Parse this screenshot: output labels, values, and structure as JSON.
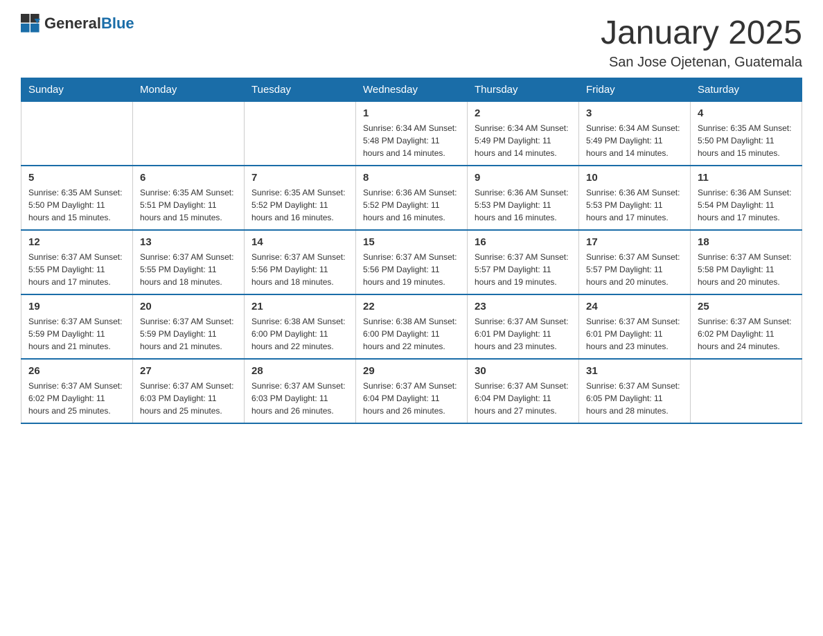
{
  "header": {
    "logo": {
      "general": "General",
      "blue": "Blue"
    },
    "title": "January 2025",
    "location": "San Jose Ojetenan, Guatemala"
  },
  "weekdays": [
    "Sunday",
    "Monday",
    "Tuesday",
    "Wednesday",
    "Thursday",
    "Friday",
    "Saturday"
  ],
  "weeks": [
    [
      {
        "day": "",
        "info": ""
      },
      {
        "day": "",
        "info": ""
      },
      {
        "day": "",
        "info": ""
      },
      {
        "day": "1",
        "info": "Sunrise: 6:34 AM\nSunset: 5:48 PM\nDaylight: 11 hours\nand 14 minutes."
      },
      {
        "day": "2",
        "info": "Sunrise: 6:34 AM\nSunset: 5:49 PM\nDaylight: 11 hours\nand 14 minutes."
      },
      {
        "day": "3",
        "info": "Sunrise: 6:34 AM\nSunset: 5:49 PM\nDaylight: 11 hours\nand 14 minutes."
      },
      {
        "day": "4",
        "info": "Sunrise: 6:35 AM\nSunset: 5:50 PM\nDaylight: 11 hours\nand 15 minutes."
      }
    ],
    [
      {
        "day": "5",
        "info": "Sunrise: 6:35 AM\nSunset: 5:50 PM\nDaylight: 11 hours\nand 15 minutes."
      },
      {
        "day": "6",
        "info": "Sunrise: 6:35 AM\nSunset: 5:51 PM\nDaylight: 11 hours\nand 15 minutes."
      },
      {
        "day": "7",
        "info": "Sunrise: 6:35 AM\nSunset: 5:52 PM\nDaylight: 11 hours\nand 16 minutes."
      },
      {
        "day": "8",
        "info": "Sunrise: 6:36 AM\nSunset: 5:52 PM\nDaylight: 11 hours\nand 16 minutes."
      },
      {
        "day": "9",
        "info": "Sunrise: 6:36 AM\nSunset: 5:53 PM\nDaylight: 11 hours\nand 16 minutes."
      },
      {
        "day": "10",
        "info": "Sunrise: 6:36 AM\nSunset: 5:53 PM\nDaylight: 11 hours\nand 17 minutes."
      },
      {
        "day": "11",
        "info": "Sunrise: 6:36 AM\nSunset: 5:54 PM\nDaylight: 11 hours\nand 17 minutes."
      }
    ],
    [
      {
        "day": "12",
        "info": "Sunrise: 6:37 AM\nSunset: 5:55 PM\nDaylight: 11 hours\nand 17 minutes."
      },
      {
        "day": "13",
        "info": "Sunrise: 6:37 AM\nSunset: 5:55 PM\nDaylight: 11 hours\nand 18 minutes."
      },
      {
        "day": "14",
        "info": "Sunrise: 6:37 AM\nSunset: 5:56 PM\nDaylight: 11 hours\nand 18 minutes."
      },
      {
        "day": "15",
        "info": "Sunrise: 6:37 AM\nSunset: 5:56 PM\nDaylight: 11 hours\nand 19 minutes."
      },
      {
        "day": "16",
        "info": "Sunrise: 6:37 AM\nSunset: 5:57 PM\nDaylight: 11 hours\nand 19 minutes."
      },
      {
        "day": "17",
        "info": "Sunrise: 6:37 AM\nSunset: 5:57 PM\nDaylight: 11 hours\nand 20 minutes."
      },
      {
        "day": "18",
        "info": "Sunrise: 6:37 AM\nSunset: 5:58 PM\nDaylight: 11 hours\nand 20 minutes."
      }
    ],
    [
      {
        "day": "19",
        "info": "Sunrise: 6:37 AM\nSunset: 5:59 PM\nDaylight: 11 hours\nand 21 minutes."
      },
      {
        "day": "20",
        "info": "Sunrise: 6:37 AM\nSunset: 5:59 PM\nDaylight: 11 hours\nand 21 minutes."
      },
      {
        "day": "21",
        "info": "Sunrise: 6:38 AM\nSunset: 6:00 PM\nDaylight: 11 hours\nand 22 minutes."
      },
      {
        "day": "22",
        "info": "Sunrise: 6:38 AM\nSunset: 6:00 PM\nDaylight: 11 hours\nand 22 minutes."
      },
      {
        "day": "23",
        "info": "Sunrise: 6:37 AM\nSunset: 6:01 PM\nDaylight: 11 hours\nand 23 minutes."
      },
      {
        "day": "24",
        "info": "Sunrise: 6:37 AM\nSunset: 6:01 PM\nDaylight: 11 hours\nand 23 minutes."
      },
      {
        "day": "25",
        "info": "Sunrise: 6:37 AM\nSunset: 6:02 PM\nDaylight: 11 hours\nand 24 minutes."
      }
    ],
    [
      {
        "day": "26",
        "info": "Sunrise: 6:37 AM\nSunset: 6:02 PM\nDaylight: 11 hours\nand 25 minutes."
      },
      {
        "day": "27",
        "info": "Sunrise: 6:37 AM\nSunset: 6:03 PM\nDaylight: 11 hours\nand 25 minutes."
      },
      {
        "day": "28",
        "info": "Sunrise: 6:37 AM\nSunset: 6:03 PM\nDaylight: 11 hours\nand 26 minutes."
      },
      {
        "day": "29",
        "info": "Sunrise: 6:37 AM\nSunset: 6:04 PM\nDaylight: 11 hours\nand 26 minutes."
      },
      {
        "day": "30",
        "info": "Sunrise: 6:37 AM\nSunset: 6:04 PM\nDaylight: 11 hours\nand 27 minutes."
      },
      {
        "day": "31",
        "info": "Sunrise: 6:37 AM\nSunset: 6:05 PM\nDaylight: 11 hours\nand 28 minutes."
      },
      {
        "day": "",
        "info": ""
      }
    ]
  ]
}
